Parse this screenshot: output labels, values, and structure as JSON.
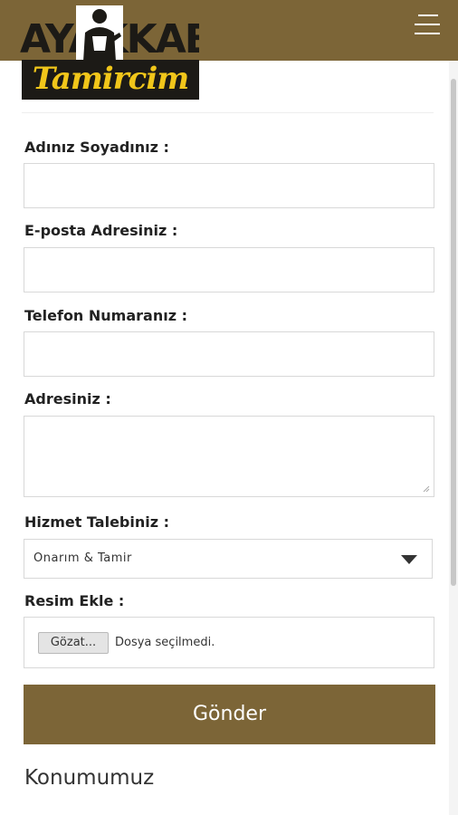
{
  "header": {
    "logo_top": "AYAKKABI",
    "logo_bottom": "Tamircim",
    "menu_icon": "hamburger-menu-icon"
  },
  "colors": {
    "brand": "#7c6537",
    "logo_yellow": "#f1c61a",
    "logo_dark": "#1c1a16"
  },
  "form": {
    "name_label": "Adınız Soyadınız :",
    "name_value": "",
    "email_label": "E-posta Adresiniz :",
    "email_value": "",
    "phone_label": "Telefon Numaranız :",
    "phone_value": "",
    "address_label": "Adresiniz :",
    "address_value": "",
    "service_label": "Hizmet Talebiniz :",
    "service_selected": "Onarım & Tamir",
    "image_label": "Resim Ekle :",
    "file_button": "Gözat...",
    "file_status": "Dosya seçilmedi.",
    "submit_label": "Gönder"
  },
  "location": {
    "title": "Konumumuz"
  }
}
